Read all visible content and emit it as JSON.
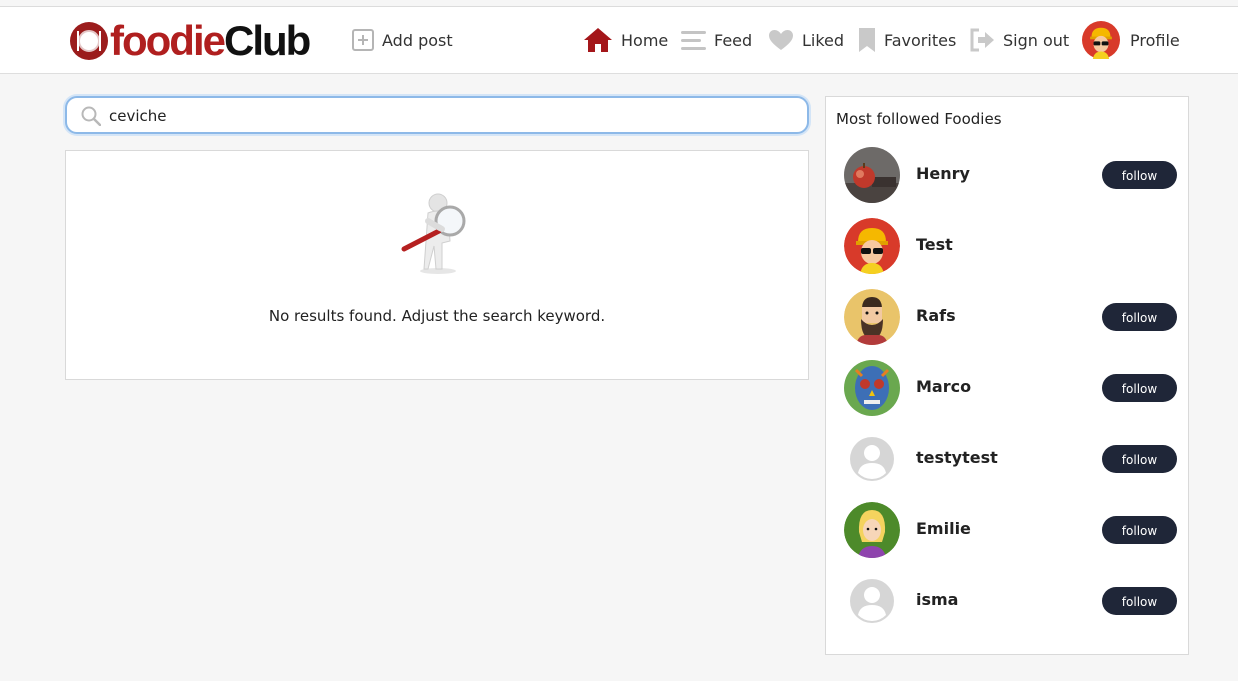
{
  "app": {
    "logo_part1": "foodie",
    "logo_part2": "Club"
  },
  "nav": {
    "add_post": "Add post",
    "home": "Home",
    "feed": "Feed",
    "liked": "Liked",
    "favorites": "Favorites",
    "sign_out": "Sign out",
    "profile": "Profile"
  },
  "search": {
    "value": "ceviche"
  },
  "results": {
    "empty_message": "No results found. Adjust the search keyword."
  },
  "sidebar": {
    "title": "Most followed Foodies",
    "follow_label": "follow",
    "foodies": [
      {
        "name": "Henry",
        "avatar": "apple-photo",
        "follow": true
      },
      {
        "name": "Test",
        "avatar": "construction-worker",
        "follow": false
      },
      {
        "name": "Rafs",
        "avatar": "bearded-man",
        "follow": true
      },
      {
        "name": "Marco",
        "avatar": "sugar-skull",
        "follow": true
      },
      {
        "name": "testytest",
        "avatar": "default-user",
        "follow": true
      },
      {
        "name": "Emilie",
        "avatar": "blonde-woman",
        "follow": true
      },
      {
        "name": "isma",
        "avatar": "default-user",
        "follow": true
      }
    ]
  },
  "colors": {
    "brand_red": "#b01f1f",
    "button_dark": "#1f2638",
    "search_focus": "#8db9e8"
  }
}
